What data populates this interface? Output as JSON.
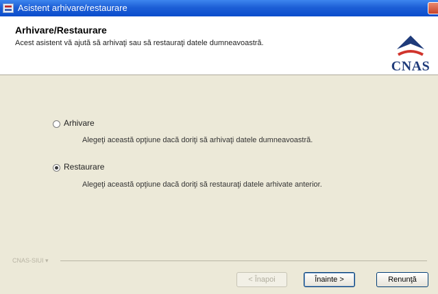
{
  "window": {
    "title": "Asistent arhivare/restaurare"
  },
  "header": {
    "title": "Arhivare/Restaurare",
    "subtitle": "Acest asistent vă ajută să arhivaţi sau să restauraţi datele dumneavoastră.",
    "logo_text": "CNAS"
  },
  "options": [
    {
      "label": "Arhivare",
      "description": "Alegeţi această opţiune dacă doriţi să arhivaţi datele dumneavoastră.",
      "selected": false
    },
    {
      "label": "Restaurare",
      "description": "Alegeţi această opţiune dacă doriţi să restauraţi datele arhivate anterior.",
      "selected": true
    }
  ],
  "footer": {
    "brand": "CNAS-SIUI ▾",
    "back_label": "< Înapoi",
    "next_label": "Înainte >",
    "cancel_label": "Renunţă"
  },
  "colors": {
    "title_bar": "#0a4ccc",
    "logo": "#1f3b7a",
    "dialog_bg": "#ece9d8"
  }
}
